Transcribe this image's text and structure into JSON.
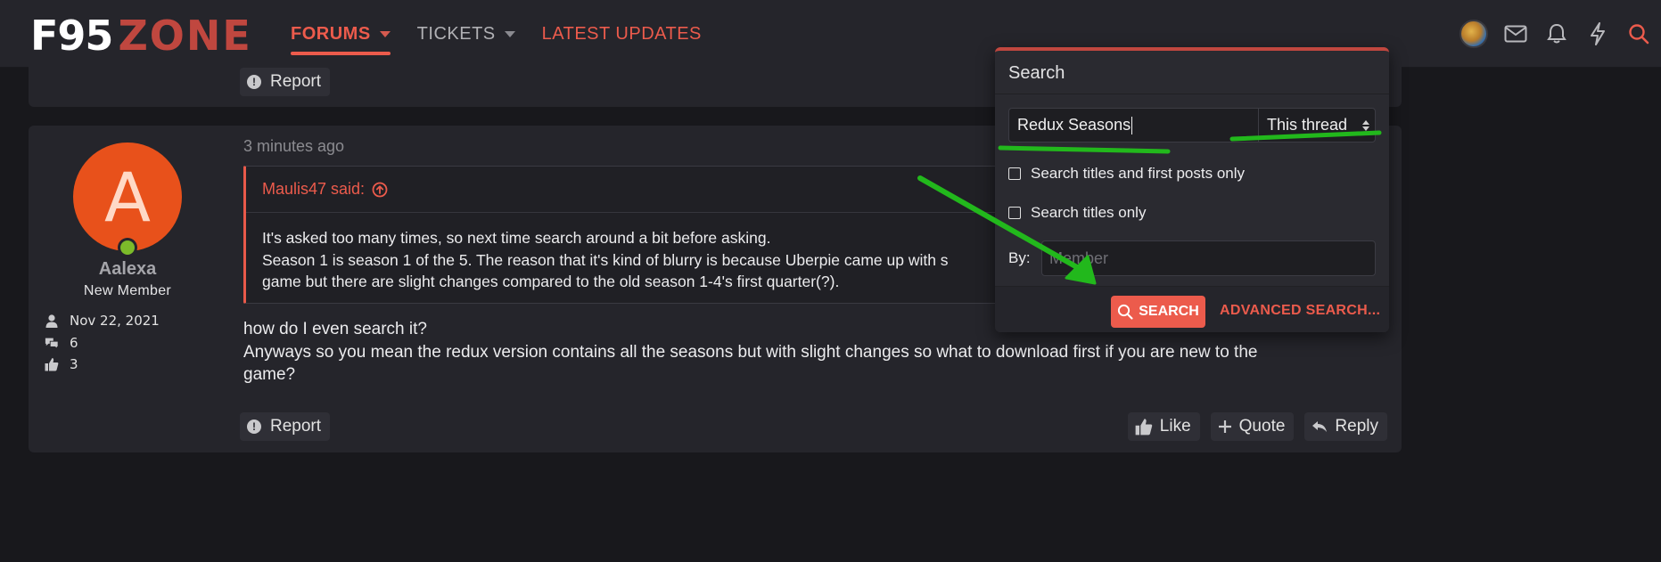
{
  "header": {
    "logo_left": "F95",
    "logo_right": "ZONE",
    "nav": [
      {
        "label": "FORUMS",
        "active": true,
        "has_dropdown": true
      },
      {
        "label": "TICKETS",
        "active": false,
        "has_dropdown": true
      },
      {
        "label": "LATEST UPDATES",
        "active": false,
        "has_dropdown": false
      }
    ],
    "icons": [
      "user-avatar",
      "mail-icon",
      "bell-icon",
      "bolt-icon",
      "search-icon"
    ]
  },
  "prev_post": {
    "report_label": "Report"
  },
  "post": {
    "author": {
      "initial": "A",
      "name": "Aalexa",
      "title": "New Member",
      "avatar_color": "#e8511b",
      "stats": [
        {
          "icon": "user-icon",
          "value": "Nov 22, 2021"
        },
        {
          "icon": "messages-icon",
          "value": "6"
        },
        {
          "icon": "thumbs-up-icon",
          "value": "3"
        }
      ]
    },
    "timestamp": "3 minutes ago",
    "quote": {
      "attribution": "Maulis47 said:",
      "lines": [
        "It's asked too many times, so next time search around a bit before asking.",
        "Season 1 is season 1 of the 5. The reason that it's kind of blurry is because Uberpie came up with s",
        "game but there are slight changes compared to the old season 1-4's first quarter(?)."
      ]
    },
    "body_lines": [
      "how do I even search it?",
      "Anyways so you mean the redux version contains all the seasons but with slight changes so what to download first if you are new to the",
      "game?"
    ],
    "actions": {
      "report": "Report",
      "like": "Like",
      "quote": "Quote",
      "reply": "Reply"
    }
  },
  "search_panel": {
    "title": "Search",
    "query_value": "Redux Seasons",
    "scope_selected": "This thread",
    "option_titles_first_posts": "Search titles and first posts only",
    "option_titles_only": "Search titles only",
    "by_label": "By:",
    "member_placeholder": "Member",
    "search_button": "SEARCH",
    "advanced_link": "ADVANCED SEARCH..."
  },
  "colors": {
    "accent": "#ec5b4c",
    "brand_dark_red": "#c0473f",
    "panel": "#25252b",
    "background": "#18181c",
    "annotation_green": "#22b81c"
  }
}
